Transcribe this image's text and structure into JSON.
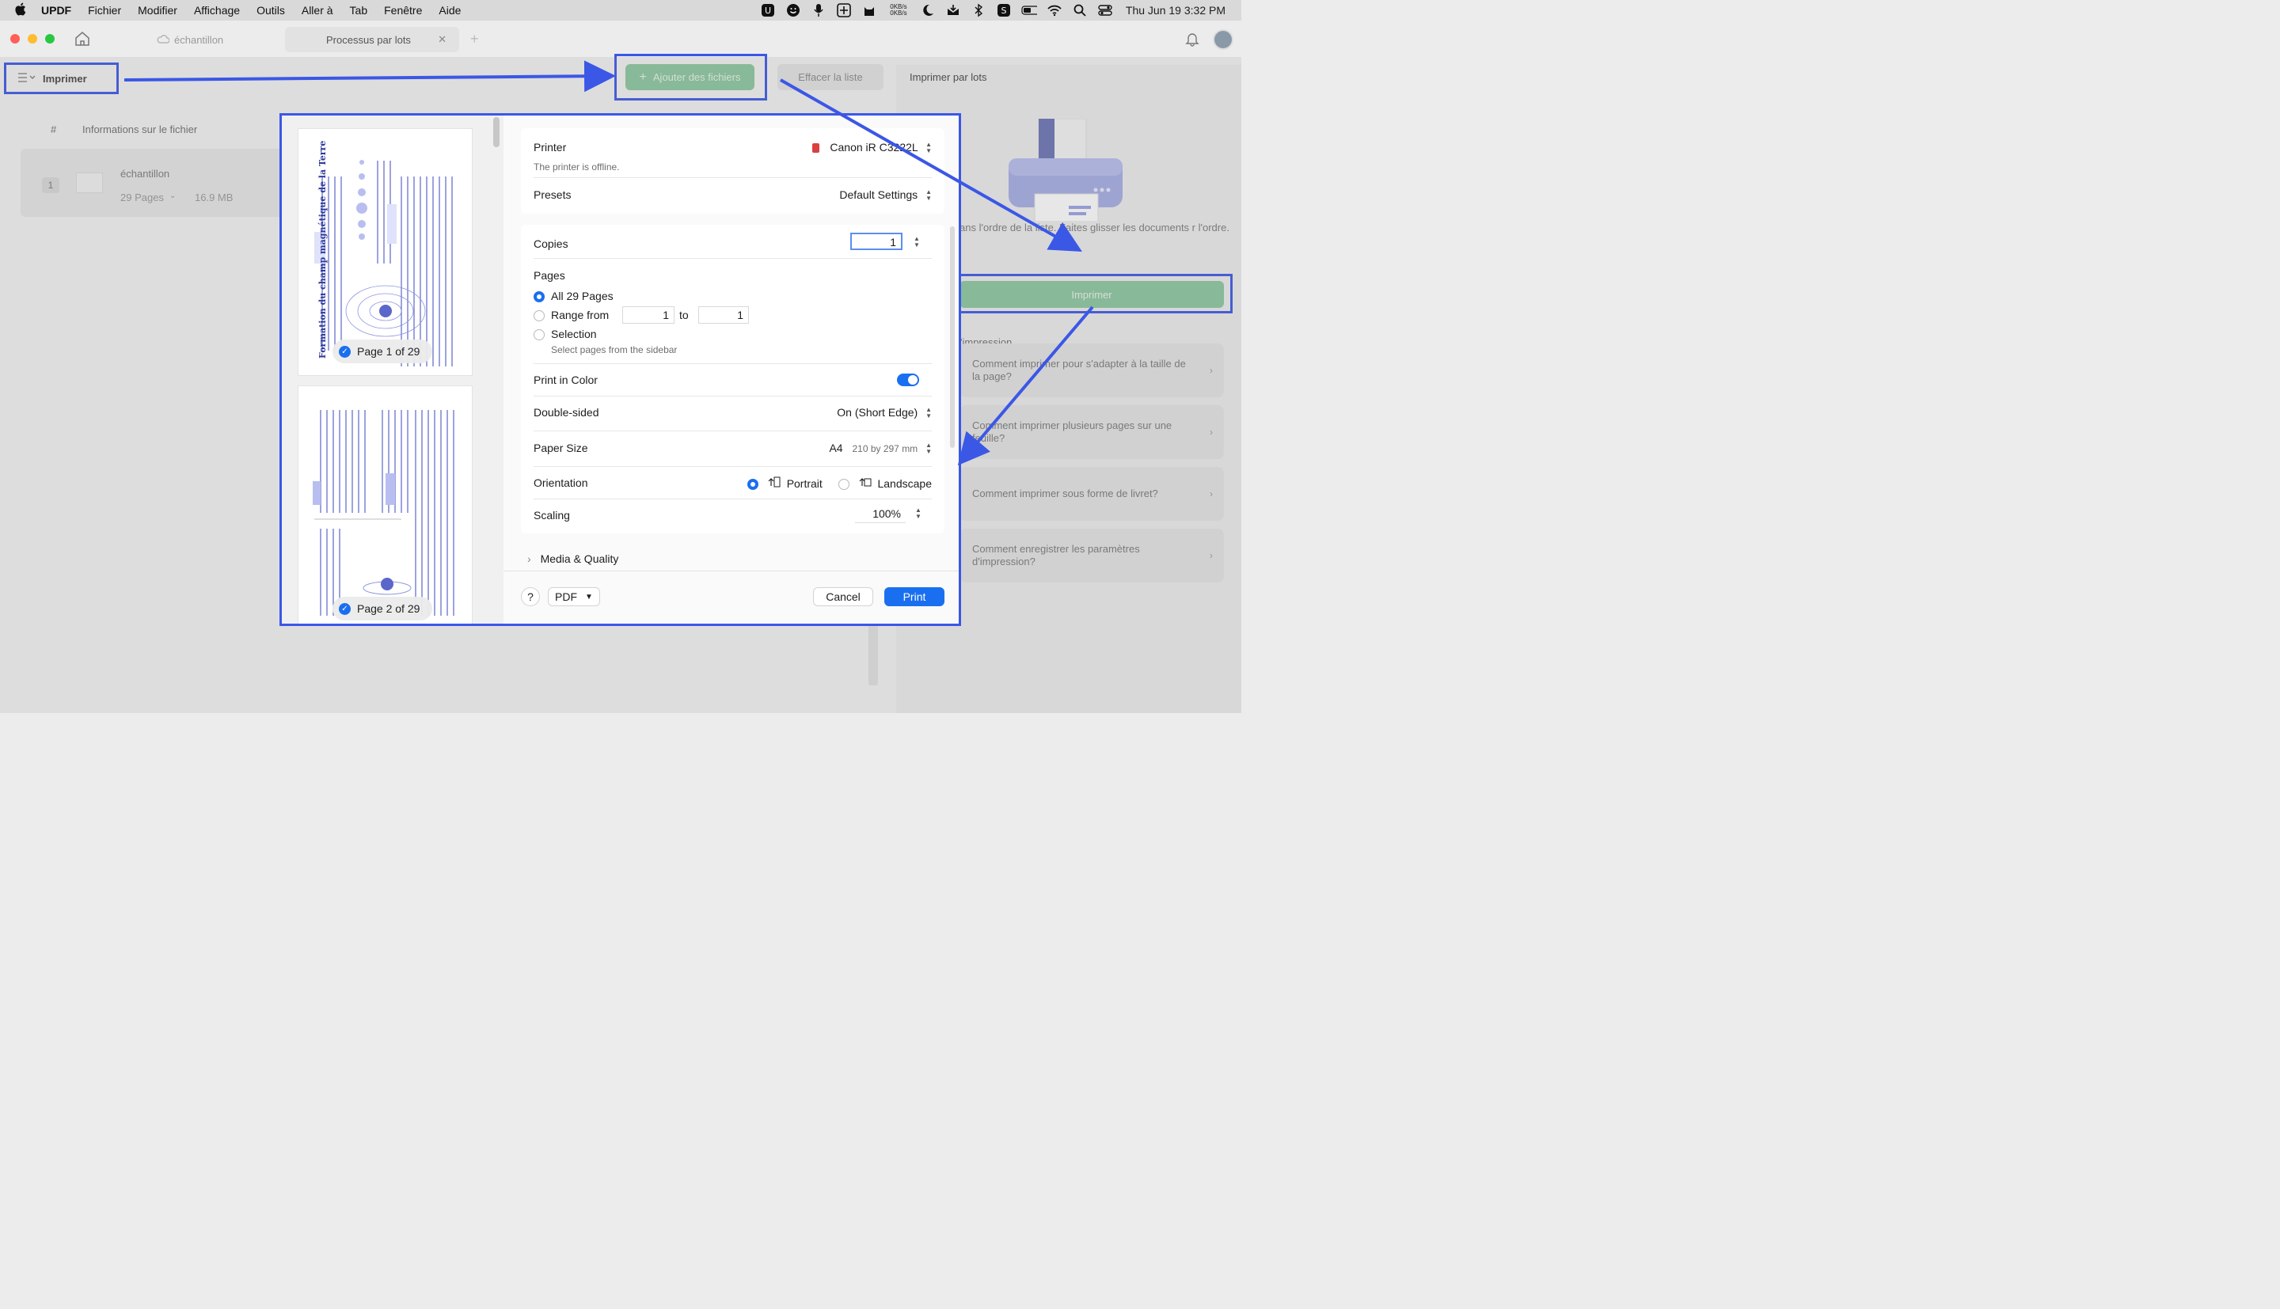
{
  "menubar": {
    "app": "UPDF",
    "items": [
      "Fichier",
      "Modifier",
      "Affichage",
      "Outils",
      "Aller à",
      "Tab",
      "Fenêtre",
      "Aide"
    ],
    "netspeed_up": "0KB/s",
    "netspeed_down": "0KB/s",
    "clock": "Thu Jun 19  3:32 PM"
  },
  "tabs": {
    "tab1": "échantillon",
    "tab2": "Processus par lots"
  },
  "toolbar": {
    "imprimer": "Imprimer",
    "add_files": "Ajouter des fichiers",
    "clear_list": "Effacer la liste"
  },
  "file_list": {
    "col_num": "#",
    "col_info": "Informations sur le fichier",
    "rows": [
      {
        "index": "1",
        "name": "échantillon",
        "pages": "29 Pages",
        "size": "16.9 MB"
      }
    ]
  },
  "right_panel": {
    "title": "Imprimer par lots",
    "description": "ans l'ordre de la liste. Faites glisser les documents r l'ordre.",
    "print_button": "Imprimer",
    "section": "'impression",
    "faqs": [
      "Comment imprimer pour s'adapter à la taille de la page?",
      "Comment imprimer plusieurs pages sur une feuille?",
      "Comment imprimer sous forme de livret?",
      "Comment enregistrer les paramètres d'impression?"
    ]
  },
  "print_dialog": {
    "thumbs": [
      {
        "label": "Page 1 of 29",
        "text": "Formation du champ magnétique de la Terre"
      },
      {
        "label": "Page 2 of 29"
      }
    ],
    "printer_label": "Printer",
    "printer_value": "Canon iR C3222L",
    "printer_status": "The printer is offline.",
    "presets_label": "Presets",
    "presets_value": "Default Settings",
    "copies_label": "Copies",
    "copies_value": "1",
    "pages_label": "Pages",
    "pages_all": "All 29 Pages",
    "pages_range": "Range from",
    "range_from": "1",
    "range_to_label": "to",
    "range_to": "1",
    "pages_selection": "Selection",
    "pages_selection_hint": "Select pages from the sidebar",
    "color_label": "Print in Color",
    "color_on": true,
    "duplex_label": "Double-sided",
    "duplex_value": "On (Short Edge)",
    "paper_label": "Paper Size",
    "paper_value": "A4",
    "paper_dims": "210 by 297 mm",
    "orientation_label": "Orientation",
    "orientation_portrait": "Portrait",
    "orientation_landscape": "Landscape",
    "scaling_label": "Scaling",
    "scaling_value": "100%",
    "media_label": "Media & Quality",
    "help": "?",
    "pdf": "PDF",
    "cancel": "Cancel",
    "print": "Print"
  },
  "colors": {
    "annotation_blue": "#3b57e6",
    "accent_blue": "#1a6ff0",
    "green": "#8cc79f"
  }
}
